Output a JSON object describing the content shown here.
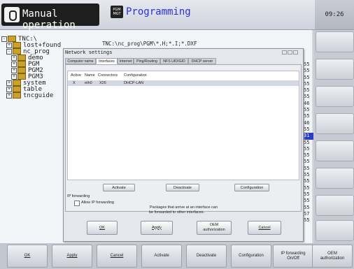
{
  "header": {
    "mode_machine": "Manual operation",
    "mode_program_icon": "PGM\nMGT",
    "mode_program": "Programming",
    "clock": "09:26"
  },
  "file_manager": {
    "path": "TNC:\\nc_prog\\PGM\\*.H;*.I;*.DXF",
    "tree": [
      {
        "label": "TNC:\\",
        "level": 0
      },
      {
        "label": "lost+found",
        "level": 1
      },
      {
        "label": "nc_prog",
        "level": 1
      },
      {
        "label": "demo",
        "level": 2
      },
      {
        "label": "PGM",
        "level": 2
      },
      {
        "label": "PGM2",
        "level": 2
      },
      {
        "label": "PGM3",
        "level": 2
      },
      {
        "label": "system",
        "level": 1
      },
      {
        "label": "table",
        "level": 1
      },
      {
        "label": "tncguide",
        "level": 1
      }
    ],
    "right_numbers": [
      "55",
      "55",
      "55",
      "55",
      "55",
      "55",
      "46",
      "55",
      "55",
      "46",
      "55",
      "31",
      "55",
      "55",
      "55",
      "55",
      "55",
      "55",
      "55",
      "55",
      "55",
      "55",
      "55",
      "57",
      "55"
    ],
    "highlighted_index": 11
  },
  "dialog": {
    "title": "Network settings",
    "tabs": [
      "Computer name",
      "Interfaces",
      "Internet",
      "Ping/Routing",
      "NFS UID/GID",
      "DHCP server"
    ],
    "active_tab": 1,
    "table": {
      "columns": [
        "Active",
        "Name",
        "Connectors",
        "Configuration"
      ],
      "rows": [
        [
          "X",
          "eth0",
          "X26",
          "DHCP-LAN"
        ]
      ]
    },
    "buttons": {
      "activate": "Activate",
      "deactivate": "Deactivate",
      "configuration": "Configuration"
    },
    "ip_forwarding": {
      "group_label": "IP forwarding",
      "checkbox_label": "Allow IP forwarding",
      "checked": false,
      "note_line1": "Packages that arrive at an interface can",
      "note_line2": "be forwarded to other interfaces."
    },
    "footer": {
      "ok": "OK",
      "apply": "Apply",
      "oem_line1": "OEM",
      "oem_line2": "authorization",
      "cancel": "Cancel"
    }
  },
  "softkeys": {
    "ok": "OK",
    "apply": "Apply",
    "cancel": "Cancel",
    "activate": "Activate",
    "deactivate": "Deactivate",
    "configuration": "Configuration",
    "ip_forwarding_line1": "IP forwarding",
    "ip_forwarding_line2": "On/Off",
    "oem_line1": "OEM",
    "oem_line2": "authorization"
  }
}
